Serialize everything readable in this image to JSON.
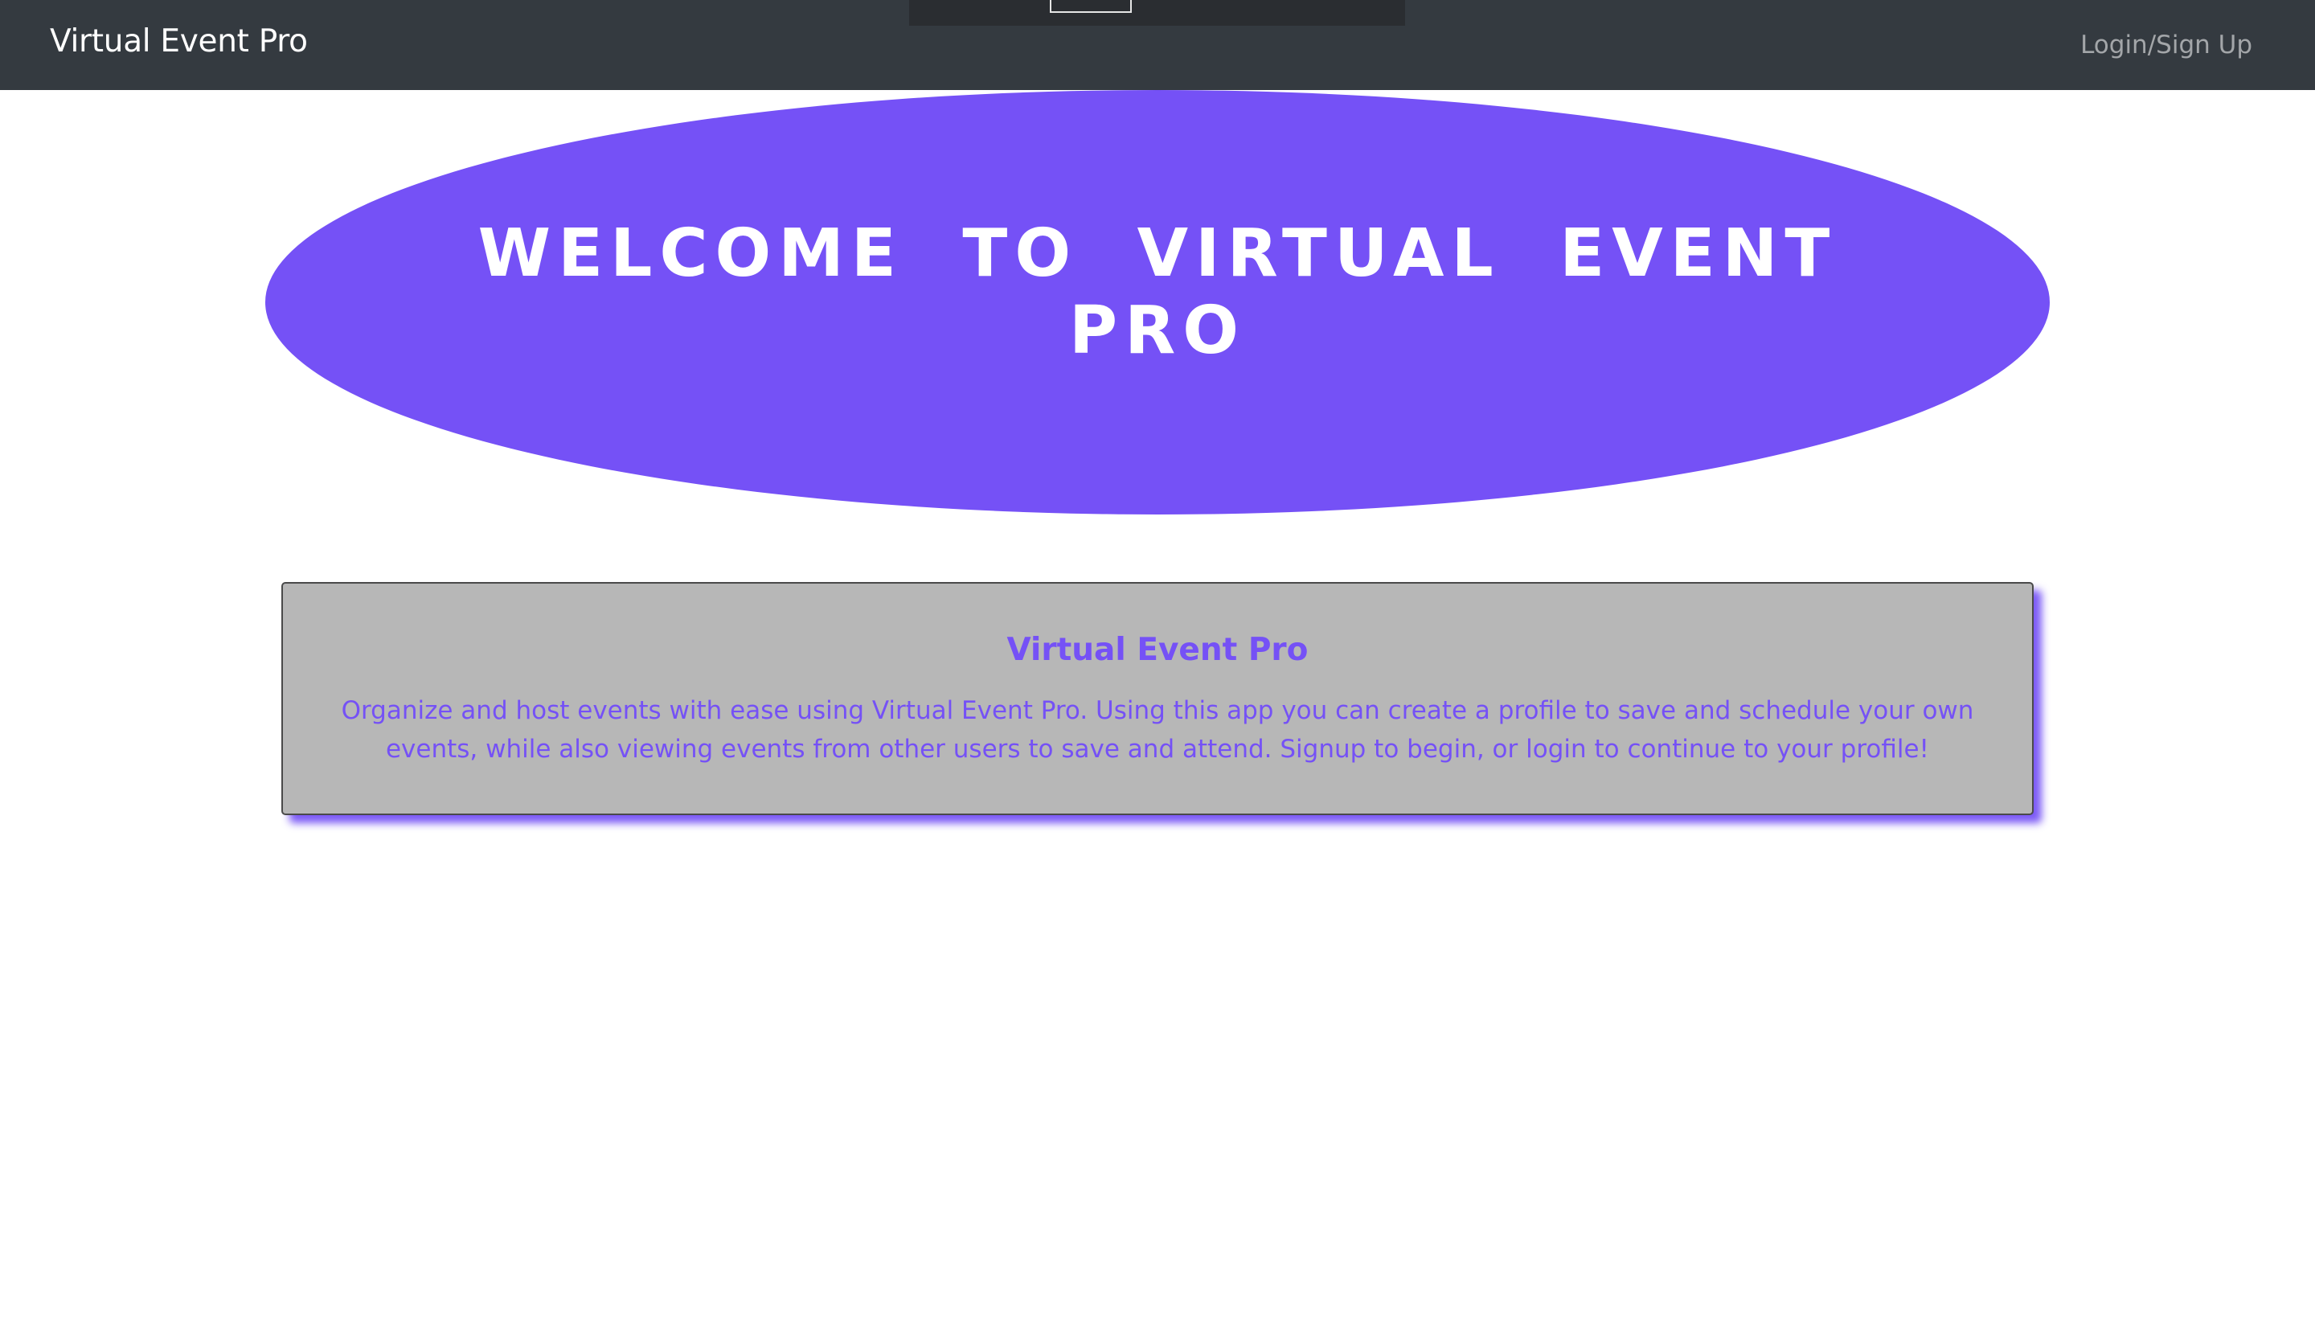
{
  "navbar": {
    "brand": "Virtual Event Pro",
    "login_link": "Login/Sign Up"
  },
  "hero": {
    "title": "Welcome to Virtual Event Pro"
  },
  "card": {
    "title": "Virtual Event Pro",
    "text": "Organize and host events with ease using Virtual Event Pro. Using this app you can create a profile to save and schedule your own events, while also viewing events from other users to save and attend. Signup to begin, or login to continue to your profile!"
  },
  "colors": {
    "navbar_bg": "#343a40",
    "accent": "#7551f6",
    "card_bg": "#b7b7b7"
  }
}
